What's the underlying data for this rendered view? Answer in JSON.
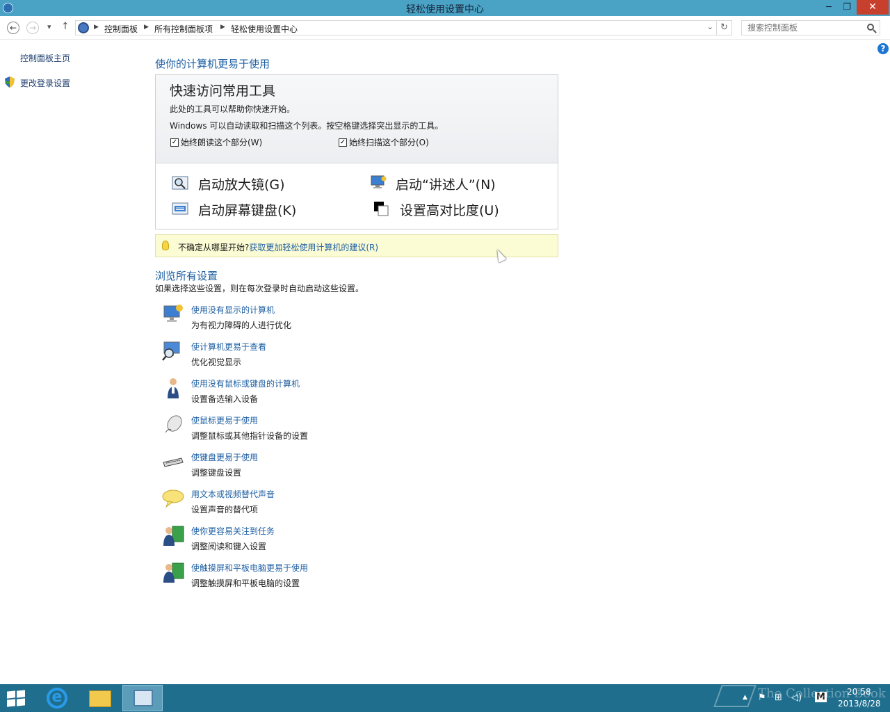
{
  "window": {
    "title": "轻松使用设置中心",
    "minimize": "─",
    "restore": "❐",
    "close": "✕"
  },
  "address": {
    "back": "←",
    "forward": "→",
    "recent": "▾",
    "up": "↑",
    "crumbs": [
      "控制面板",
      "所有控制面板项",
      "轻松使用设置中心"
    ],
    "separator": "▶",
    "dropdown": "⌄",
    "refresh": "↻"
  },
  "search": {
    "placeholder": "搜索控制面板"
  },
  "help": "?",
  "sidebar": {
    "home": "控制面板主页",
    "login_settings": "更改登录设置"
  },
  "main": {
    "heading": "使你的计算机更易于使用",
    "quick": {
      "title": "快速访问常用工具",
      "line1": "此处的工具可以帮助你快速开始。",
      "line2": "Windows 可以自动读取和扫描这个列表。按空格键选择突出显示的工具。",
      "check_read": "始终朗读这个部分(W)",
      "check_scan": "始终扫描这个部分(O)",
      "check_read_state": true,
      "check_scan_state": true,
      "check_mark": "✓",
      "tools": {
        "magnifier": "启动放大镜(G)",
        "narrator": "启动“讲述人”(N)",
        "osk": "启动屏幕键盘(K)",
        "contrast": "设置高对比度(U)"
      }
    },
    "tip": {
      "text": "不确定从哪里开始?",
      "link": "获取更加轻松使用计算机的建议(R)"
    },
    "browse": {
      "heading": "浏览所有设置",
      "subtitle": "如果选择这些设置，则在每次登录时自动启动这些设置。",
      "items": [
        {
          "link": "使用没有显示的计算机",
          "desc": "为有视力障碍的人进行优化",
          "icon": "monitor-speaker-icon"
        },
        {
          "link": "使计算机更易于查看",
          "desc": "优化视觉显示",
          "icon": "monitor-magnifier-icon"
        },
        {
          "link": "使用没有鼠标或键盘的计算机",
          "desc": "设置备选输入设备",
          "icon": "person-icon"
        },
        {
          "link": "使鼠标更易于使用",
          "desc": "调整鼠标或其他指针设备的设置",
          "icon": "mouse-icon"
        },
        {
          "link": "使键盘更易于使用",
          "desc": "调整键盘设置",
          "icon": "keyboard-icon"
        },
        {
          "link": "用文本或视频替代声音",
          "desc": "设置声音的替代项",
          "icon": "speech-bubble-icon"
        },
        {
          "link": "使你更容易关注到任务",
          "desc": "调整阅读和键入设置",
          "icon": "user-focus-icon"
        },
        {
          "link": "使触摸屏和平板电脑更易于使用",
          "desc": "调整触摸屏和平板电脑的设置",
          "icon": "user-tablet-icon"
        }
      ]
    }
  },
  "taskbar": {
    "ie_glyph": "e",
    "tray_flag": "⚑",
    "tray_network": "⊞",
    "tray_volume": "◁)",
    "tray_ime": "M",
    "tray_up": "▲",
    "time": "20:58",
    "date": "2013/8/28"
  },
  "watermark": "The Collection Book",
  "colors": {
    "titlebar": "#4aa3c4",
    "link": "#1e5fa3",
    "taskbar": "#1f6e8e",
    "tip_bg": "#fbfbd4"
  }
}
